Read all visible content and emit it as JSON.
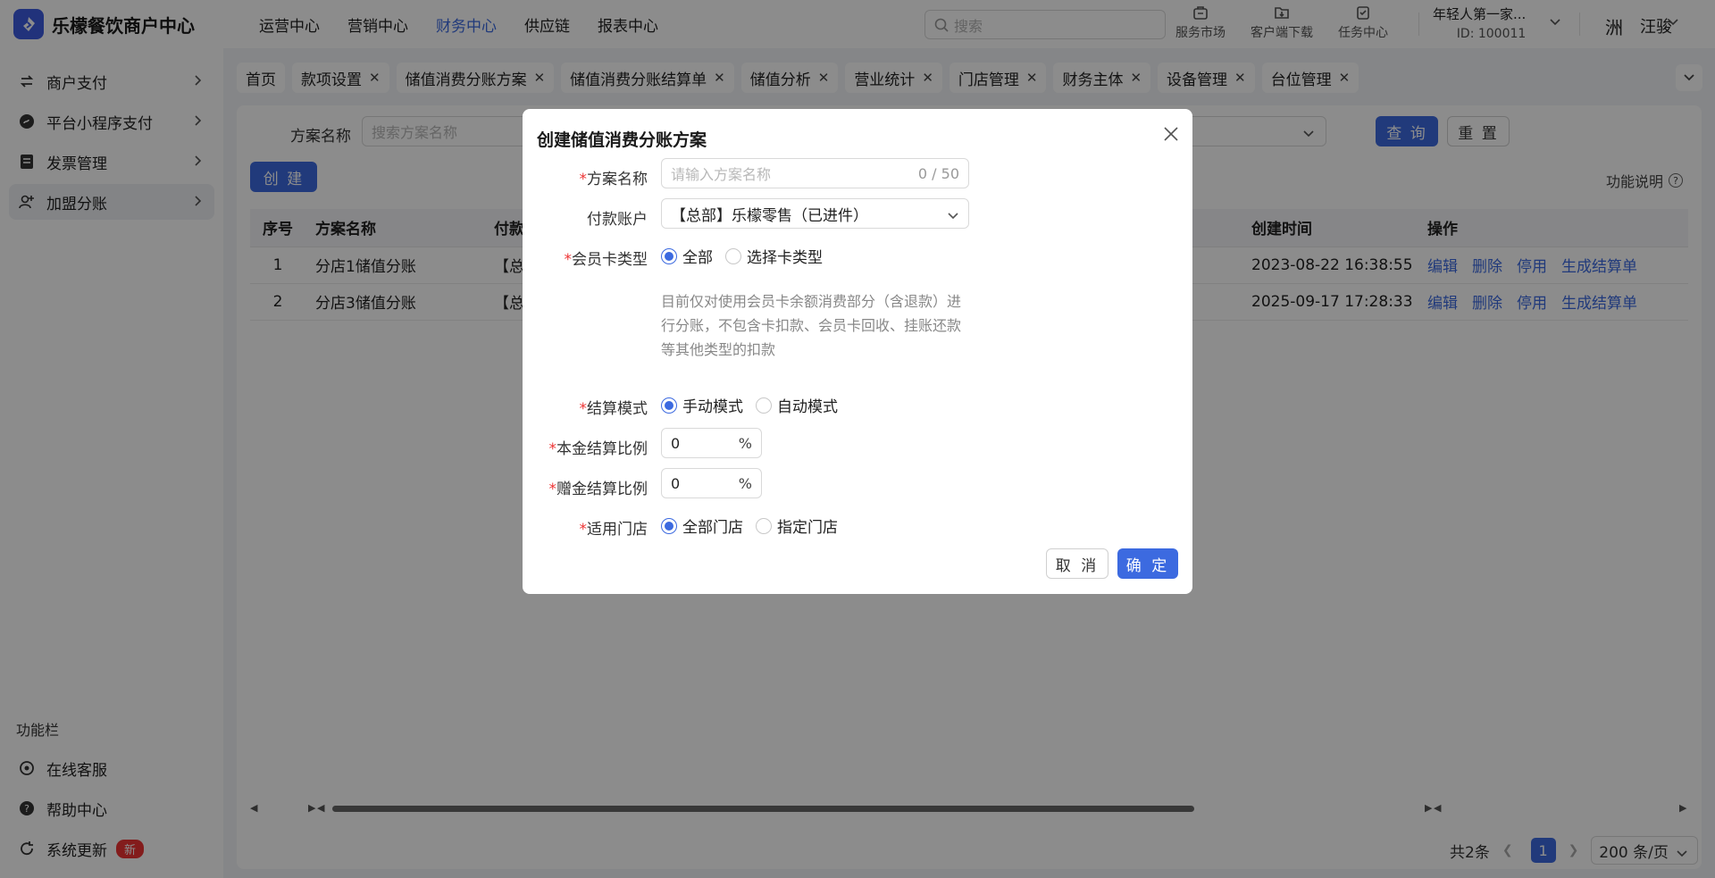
{
  "app": {
    "title": "乐檬餐饮商户中心"
  },
  "topnav": [
    "运营中心",
    "营销中心",
    "财务中心",
    "供应链",
    "报表中心"
  ],
  "search": {
    "placeholder": "搜索"
  },
  "tools": [
    {
      "label": "服务市场",
      "icon": "store-icon"
    },
    {
      "label": "客户端下载",
      "icon": "download-icon"
    },
    {
      "label": "任务中心",
      "icon": "task-icon"
    }
  ],
  "org": {
    "name": "年轻人第一家...",
    "id": "ID: 100011"
  },
  "user": {
    "name": "汪骏",
    "avatar_char": "洲"
  },
  "sidebar": {
    "items": [
      {
        "label": "商户支付",
        "icon": "transfer-icon"
      },
      {
        "label": "平台小程序支付",
        "icon": "mini-program-icon"
      },
      {
        "label": "发票管理",
        "icon": "invoice-icon"
      },
      {
        "label": "加盟分账",
        "icon": "user-add-icon"
      }
    ],
    "section": "功能栏",
    "footer": [
      {
        "label": "在线客服",
        "icon": "headset-icon"
      },
      {
        "label": "帮助中心",
        "icon": "help-icon"
      },
      {
        "label": "系统更新",
        "icon": "refresh-icon",
        "badge": "新"
      }
    ]
  },
  "tabs": [
    "首页",
    "款项设置",
    "储值消费分账方案",
    "储值消费分账结算单",
    "储值分析",
    "营业统计",
    "门店管理",
    "财务主体",
    "设备管理",
    "台位管理"
  ],
  "filter": {
    "label": "方案名称",
    "placeholder": "搜索方案名称",
    "query": "查 询",
    "reset": "重 置",
    "create": "创 建",
    "help": "功能说明"
  },
  "table": {
    "headers": [
      "序号",
      "方案名称",
      "付款",
      "创建时间",
      "操作"
    ],
    "rows": [
      {
        "no": "1",
        "name": "分店1储值分账",
        "pay": "【总",
        "created": "2023-08-22 16:38:55"
      },
      {
        "no": "2",
        "name": "分店3储值分账",
        "pay": "【总",
        "created": "2025-09-17 17:28:33"
      }
    ],
    "actions": [
      "编辑",
      "删除",
      "停用",
      "生成结算单"
    ]
  },
  "pager": {
    "total": "共2条",
    "page": "1",
    "size": "200 条/页"
  },
  "modal": {
    "title": "创建储值消费分账方案",
    "name_label": "方案名称",
    "name_placeholder": "请输入方案名称",
    "name_count": "0 / 50",
    "account_label": "付款账户",
    "account_value": "【总部】乐檬零售（已进件）",
    "card_label": "会员卡类型",
    "card_options": [
      "全部",
      "选择卡类型"
    ],
    "card_hint": "目前仅对使用会员卡余额消费部分（含退款）进行分账，不包含卡扣款、会员卡回收、挂账还款等其他类型的扣款",
    "mode_label": "结算模式",
    "mode_options": [
      "手动模式",
      "自动模式"
    ],
    "principal_label": "本金结算比例",
    "principal_value": "0",
    "bonus_label": "赠金结算比例",
    "bonus_value": "0",
    "percent_unit": "%",
    "store_label": "适用门店",
    "store_options": [
      "全部门店",
      "指定门店"
    ],
    "cancel": "取 消",
    "ok": "确 定"
  },
  "colors": {
    "primary": "#3c6ae0",
    "required": "#e33333"
  }
}
